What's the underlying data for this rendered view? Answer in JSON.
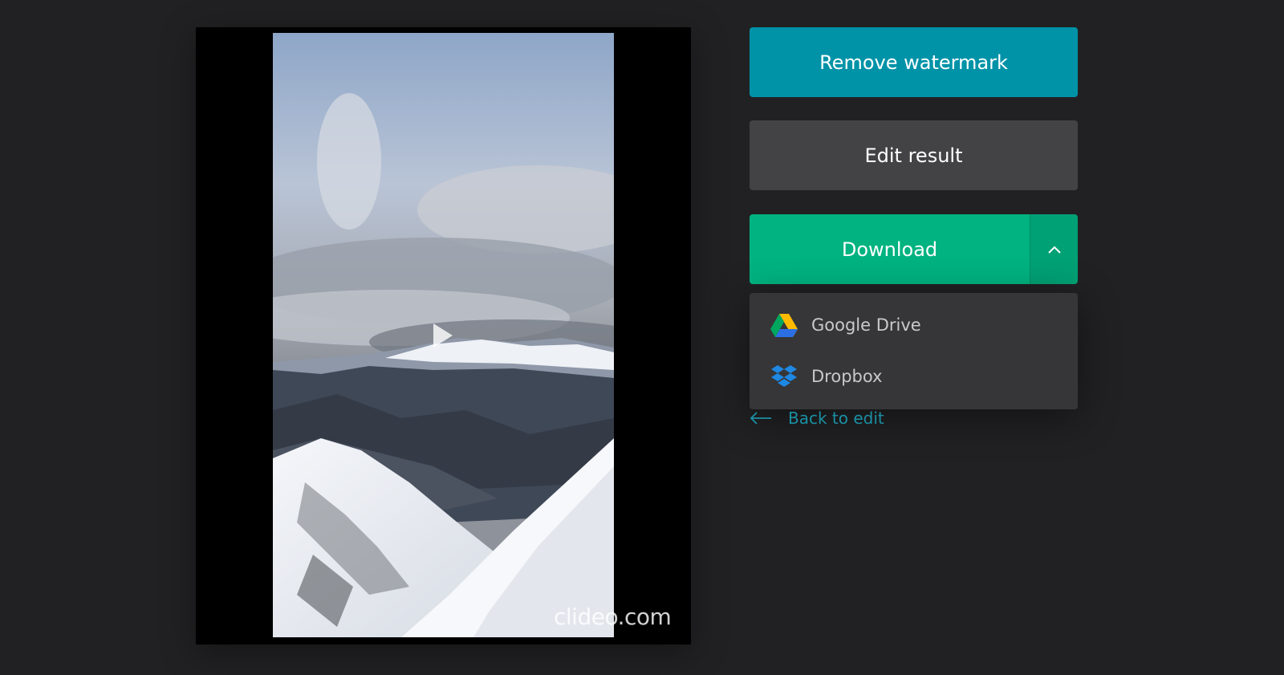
{
  "preview": {
    "watermark_text": "clideo.com",
    "play_icon": "play-icon"
  },
  "actions": {
    "remove_watermark_label": "Remove watermark",
    "edit_result_label": "Edit result",
    "download_label": "Download",
    "download_toggle_icon": "chevron-up-icon"
  },
  "download_menu": {
    "items": [
      {
        "label": "Google Drive",
        "icon": "google-drive-icon"
      },
      {
        "label": "Dropbox",
        "icon": "dropbox-icon"
      }
    ]
  },
  "back_link": {
    "label": "Back to edit",
    "icon": "arrow-left-icon"
  },
  "colors": {
    "background": "#212123",
    "remove_watermark": "#0093a8",
    "edit_result": "#434345",
    "download": "#00b380",
    "dropdown": "#363638",
    "link": "#1b8fa3"
  }
}
